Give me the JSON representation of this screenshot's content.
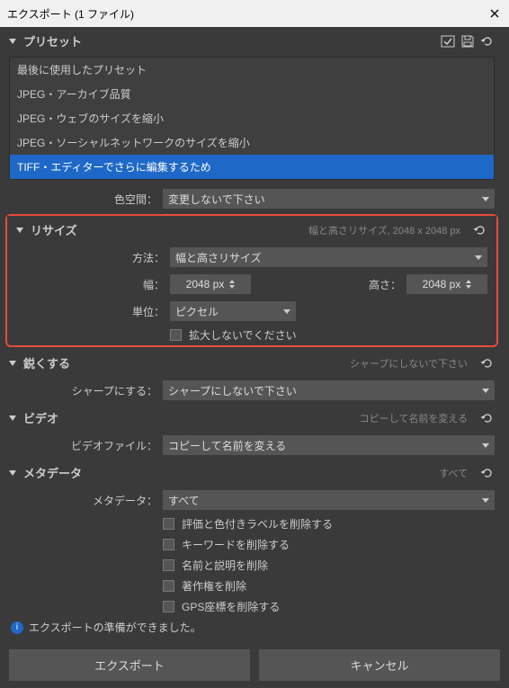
{
  "window": {
    "title": "エクスポート (1 ファイル)"
  },
  "presets": {
    "header": "プリセット",
    "items": [
      "最後に使用したプリセット",
      "JPEG・アーカイブ品質",
      "JPEG・ウェブのサイズを縮小",
      "JPEG・ソーシャルネットワークのサイズを縮小",
      "TIFF・エディターでさらに編集するため"
    ],
    "selected_index": 4
  },
  "colorspace": {
    "label": "色空間：",
    "value": "変更しないで下さい"
  },
  "resize": {
    "header": "リサイズ",
    "summary": "幅と高さリサイズ, 2048 x 2048 px",
    "method_label": "方法：",
    "method_value": "幅と高さリサイズ",
    "width_label": "幅：",
    "width_value": "2048 px",
    "height_label": "高さ：",
    "height_value": "2048 px",
    "unit_label": "単位：",
    "unit_value": "ピクセル",
    "no_upscale_label": "拡大しないでください"
  },
  "sharpen": {
    "header": "鋭くする",
    "summary": "シャープにしないで下さい",
    "label": "シャープにする：",
    "value": "シャープにしないで下さい"
  },
  "video": {
    "header": "ビデオ",
    "summary": "コピーして名前を変える",
    "label": "ビデオファイル：",
    "value": "コピーして名前を変える"
  },
  "metadata": {
    "header": "メタデータ",
    "summary": "すべて",
    "label": "メタデータ：",
    "value": "すべて",
    "checks": [
      "評価と色付きラベルを削除する",
      "キーワードを削除する",
      "名前と説明を削除",
      "著作権を削除",
      "GPS座標を削除する"
    ]
  },
  "status": "エクスポートの準備ができました。",
  "buttons": {
    "export": "エクスポート",
    "cancel": "キャンセル"
  }
}
